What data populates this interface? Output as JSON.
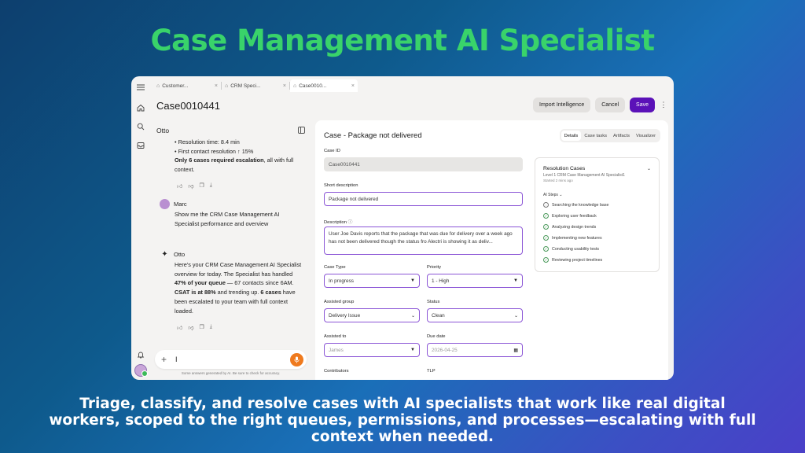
{
  "headline": "Case Management AI Specialist",
  "tagline": "Triage, classify, and resolve cases with AI specialists that work like real digital workers, scoped to the right queues, permissions, and processes—escalating with full context when needed.",
  "colors": {
    "headline": "#39d36a",
    "primary_button": "#5b12b8",
    "mic": "#ef7a1e"
  },
  "rail": {
    "icons": [
      "menu-icon",
      "home-icon",
      "search-icon",
      "inbox-icon",
      "bell-icon"
    ]
  },
  "tabs": [
    {
      "label": "Customer...",
      "icon": "tab-icon"
    },
    {
      "label": "CRM Speci...",
      "icon": "tab-icon"
    },
    {
      "label": "Case0010...",
      "icon": "tab-icon"
    }
  ],
  "page": {
    "title": "Case0010441",
    "import_label": "Import Intelligence",
    "cancel_label": "Cancel",
    "save_label": "Save"
  },
  "chat": {
    "title": "Otto",
    "msg1": {
      "line1": "• Resolution time: 8.4 min",
      "line2_pre": "• First contact resolution ",
      "line2_arrow": "↑",
      "line2_post": " 15%",
      "line3_bold": "Only 6 cases required escalation",
      "line3_rest": ", all with full context."
    },
    "user_name": "Marc",
    "user_msg": "Show me the CRM Case Management AI Specialist performance and overview",
    "bot_name": "Otto",
    "msg2": {
      "p1": "Here's your CRM Case Management AI Specialist overview for today. The Specialist has handled ",
      "b1": "47% of your queue",
      "p2": " — 67 contacts since 6AM. ",
      "b2": "CSAT is at 88%",
      "p3": " and trending up. ",
      "b3": "6 cases",
      "p4": " have been escalated to your team with full context loaded."
    },
    "input_value": "I",
    "disclaimer": "Some answers generated by AI. Be sure to check for accuracy."
  },
  "form": {
    "title": "Case - Package not delivered",
    "tabs": [
      "Details",
      "Case tasks",
      "Artifacts",
      "Visualizer"
    ],
    "case_id_label": "Case ID",
    "case_id_value": "Case0010441",
    "short_desc_label": "Short description",
    "short_desc_value": "Package not delivered",
    "desc_label": "Description",
    "desc_value": "User Joe Davis reports that the package that was due for delivery over a week ago has not been delivered though the status fro  Alectri is showing it as deliv...",
    "case_type_label": "Case Type",
    "case_type_value": "In progress",
    "priority_label": "Priority",
    "priority_value": "1 - High",
    "assigned_group_label": "Assisted group",
    "assigned_group_value": "Delivery Issue",
    "status_label": "Status",
    "status_value": "Clean",
    "assigned_to_label": "Assisted to",
    "assigned_to_value": "James",
    "due_date_label": "Due date",
    "due_date_value": "2026-04-25",
    "contributors_label": "Contributors",
    "tlp_label": "TLP"
  },
  "resolution": {
    "title": "Resolution Cases",
    "subtitle": "Level 1 CRM Case Management AI Specialist1",
    "started": "Started 2 mins ago",
    "steps_header": "AI Steps",
    "steps": [
      "Searching the knowledge base",
      "Exploring user feedback",
      "Analyzing design trends",
      "Implementing new features",
      "Conducting usability tests",
      "Reviewing project timelines"
    ]
  }
}
